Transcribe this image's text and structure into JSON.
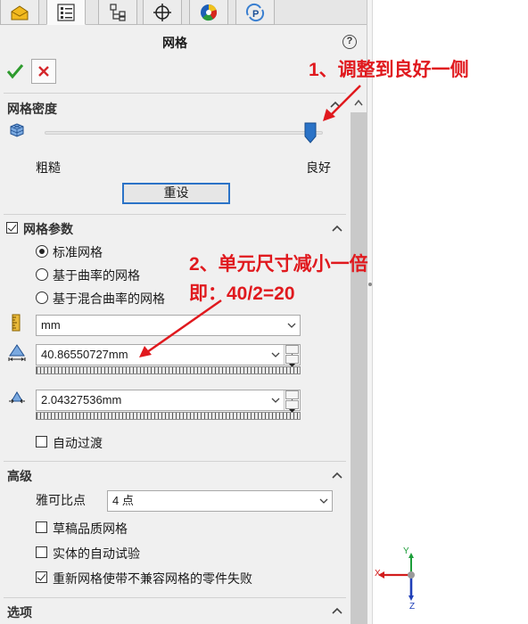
{
  "panel": {
    "title": "网格",
    "help_label": "?"
  },
  "mesh_density": {
    "title": "网格密度",
    "coarse_label": "粗糙",
    "fine_label": "良好",
    "slider_value": 1.0,
    "reset_label": "重设"
  },
  "mesh_params": {
    "title": "网格参数",
    "options": [
      {
        "label": "标准网格",
        "selected": true
      },
      {
        "label": "基于曲率的网格",
        "selected": false
      },
      {
        "label": "基于混合曲率的网格",
        "selected": false
      }
    ],
    "unit": "mm",
    "global_size": "40.86550727mm",
    "tolerance": "2.04327536mm",
    "auto_transition_label": "自动过渡"
  },
  "advanced": {
    "title": "高级",
    "jacobian_label": "雅可比点",
    "jacobian_value": "4 点",
    "draft_quality_label": "草稿品质网格",
    "auto_trials_label": "实体的自动试验",
    "remesh_label": "重新网格使带不兼容网格的零件失败"
  },
  "options_section": {
    "title": "选项"
  },
  "annotations": {
    "step1": "1、调整到良好一侧",
    "step2_line1": "2、单元尺寸减小一倍",
    "step2_line2": "即：40/2=20"
  },
  "triad": {
    "x_label": "X",
    "y_label": "Y",
    "z_label": "Z"
  },
  "colors": {
    "accent_blue": "#2b73c7",
    "annotation_red": "#e0191e",
    "ok_green": "#2e9b2e",
    "cancel_red": "#d4262b"
  }
}
